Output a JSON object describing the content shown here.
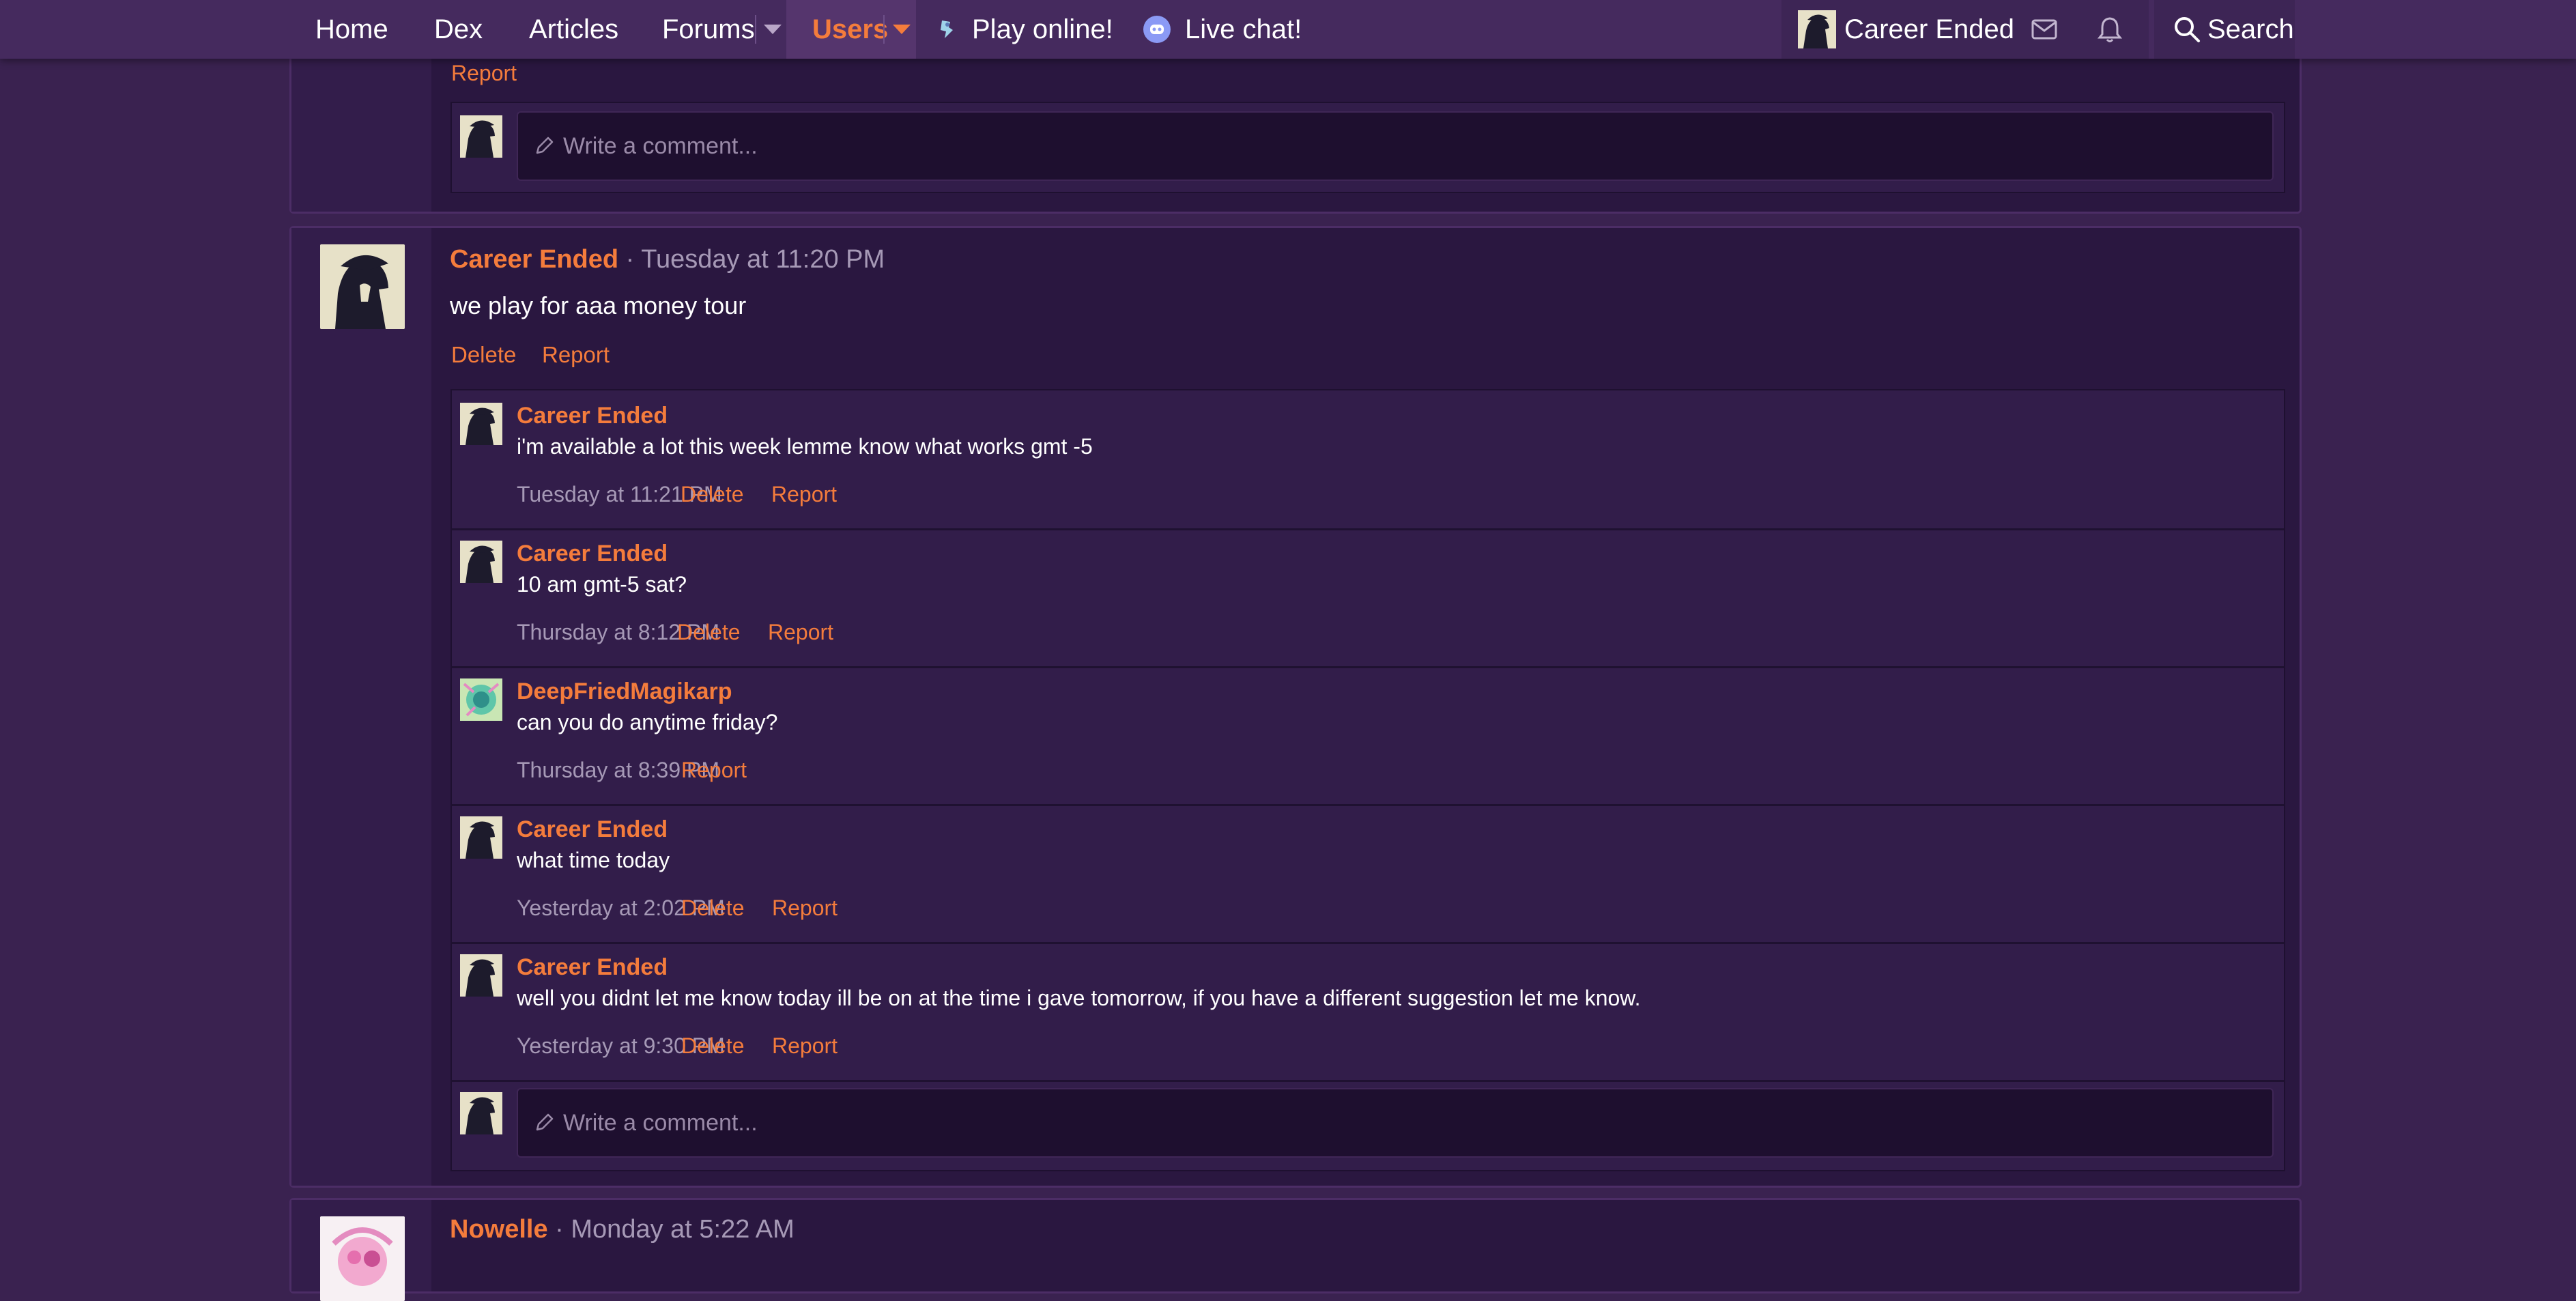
{
  "nav": {
    "home": "Home",
    "dex": "Dex",
    "articles": "Articles",
    "forums": "Forums",
    "users": "Users",
    "play_online": "Play online!",
    "live_chat": "Live chat!",
    "account_name": "Career Ended",
    "search": "Search",
    "icons": [
      "chevron-down-icon",
      "play-icon",
      "discord-icon",
      "mail-icon",
      "bell-icon",
      "search-icon"
    ]
  },
  "colors": {
    "accent": "#f47c3c",
    "background": "#3a2250",
    "topbar": "#452a5e",
    "post_bg": "#2a1740",
    "comment_bg": "#321d4a",
    "muted_text": "#a699b6"
  },
  "top_partial": {
    "report": "Report",
    "write_placeholder": "Write a comment..."
  },
  "main_post": {
    "author": "Career Ended",
    "separator": "·",
    "time": "Tuesday at 11:20 PM",
    "body": "we play for aaa money tour",
    "delete": "Delete",
    "report": "Report",
    "comments": [
      {
        "author": "Career Ended",
        "text": "i'm available a lot this week lemme know what works gmt -5",
        "time": "Tuesday at 11:21 PM",
        "delete": "Delete",
        "report": "Report"
      },
      {
        "author": "Career Ended",
        "text": "10 am gmt-5 sat?",
        "time": "Thursday at 8:12 PM",
        "delete": "Delete",
        "report": "Report"
      },
      {
        "author": "DeepFriedMagikarp",
        "text": "can you do anytime friday?",
        "time": "Thursday at 8:39 PM",
        "report": "Report"
      },
      {
        "author": "Career Ended",
        "text": "what time today",
        "time": "Yesterday at 2:02 PM",
        "delete": "Delete",
        "report": "Report"
      },
      {
        "author": "Career Ended",
        "text": "well you didnt let me know today ill be on at the time i gave tomorrow, if you have a different suggestion let me know.",
        "time": "Yesterday at 9:30 PM",
        "delete": "Delete",
        "report": "Report"
      }
    ],
    "write_placeholder": "Write a comment..."
  },
  "next_post": {
    "author": "Nowelle",
    "separator": "·",
    "time": "Monday at 5:22 AM"
  }
}
